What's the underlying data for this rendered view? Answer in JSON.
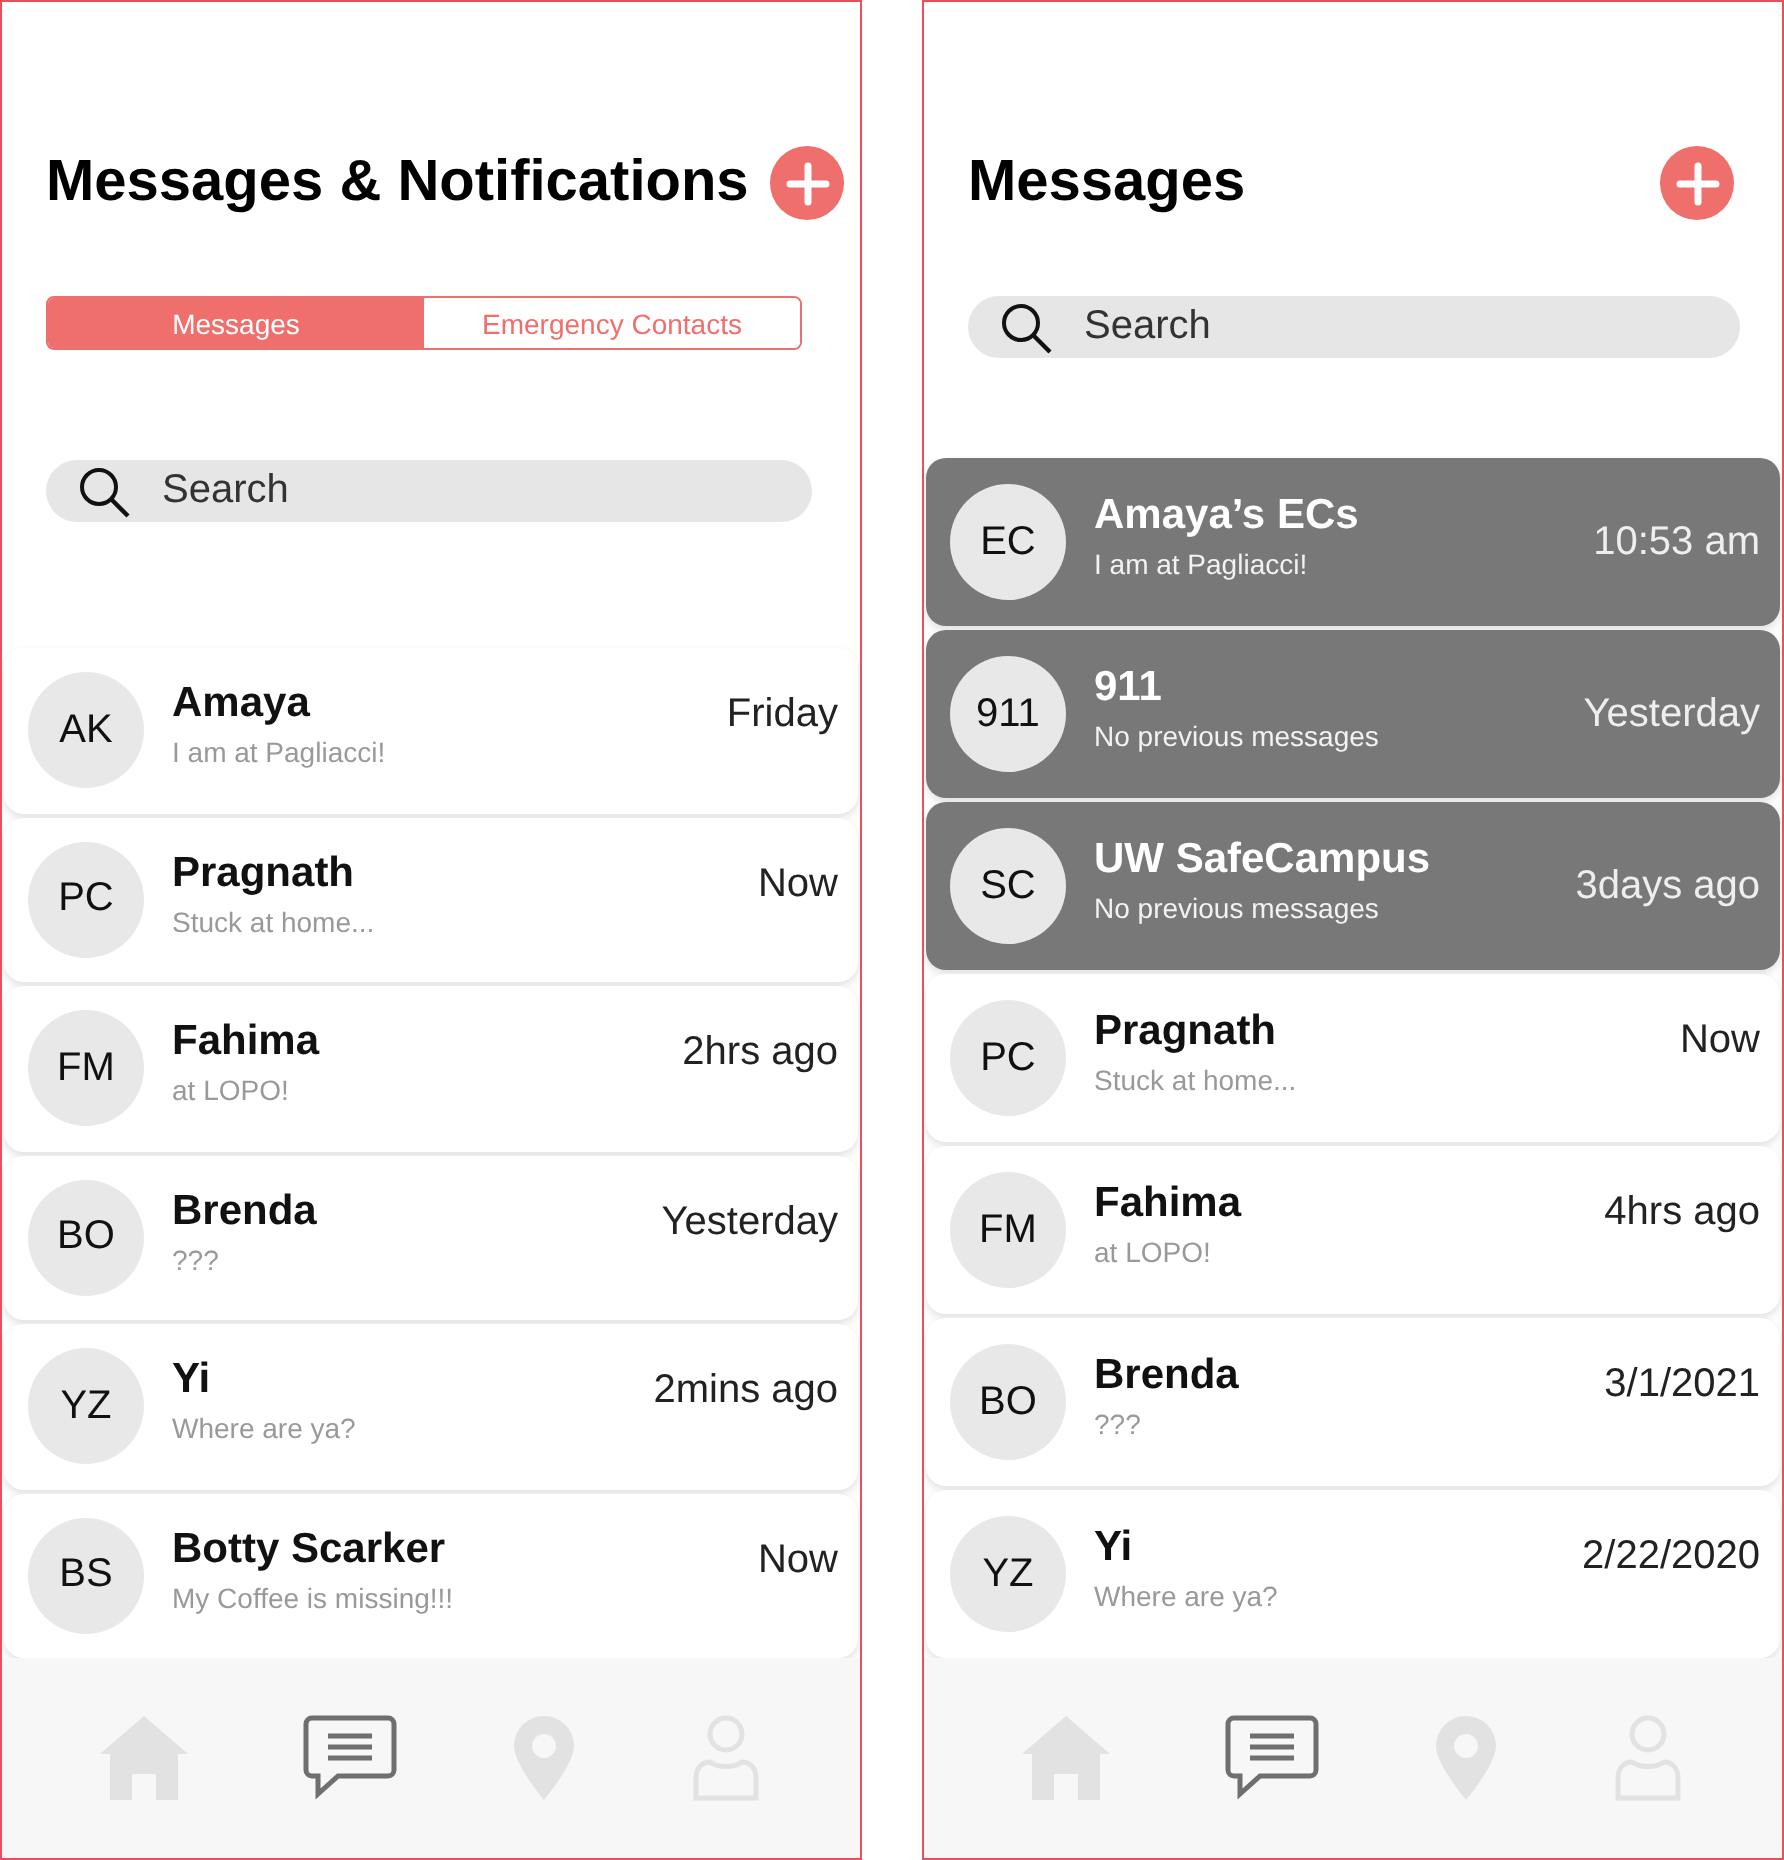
{
  "screens": [
    {
      "title": "Messages & Notifications",
      "tabs": [
        {
          "label": "Messages",
          "selected": true
        },
        {
          "label": "Emergency Contacts",
          "selected": false
        }
      ],
      "search": {
        "placeholder": "Search"
      },
      "conversations": [
        {
          "kind": "contact",
          "initials": "AK",
          "name": "Amaya",
          "preview": "I am at Pagliacci!",
          "time": "Friday"
        },
        {
          "kind": "contact",
          "initials": "PC",
          "name": "Pragnath",
          "preview": "Stuck at home...",
          "time": "Now"
        },
        {
          "kind": "contact",
          "initials": "FM",
          "name": "Fahima",
          "preview": "at LOPO!",
          "time": "2hrs ago"
        },
        {
          "kind": "contact",
          "initials": "BO",
          "name": "Brenda",
          "preview": "???",
          "time": "Yesterday"
        },
        {
          "kind": "contact",
          "initials": "YZ",
          "name": "Yi",
          "preview": "Where are ya?",
          "time": "2mins ago"
        },
        {
          "kind": "contact",
          "initials": "BS",
          "name": "Botty Scarker",
          "preview": "My Coffee is missing!!!",
          "time": "Now"
        }
      ],
      "nav": [
        {
          "kind": "home",
          "selected": false
        },
        {
          "kind": "messages",
          "selected": true
        },
        {
          "kind": "location",
          "selected": false
        },
        {
          "kind": "profile",
          "selected": false
        }
      ]
    },
    {
      "title": "Messages",
      "search": {
        "placeholder": "Search"
      },
      "conversations": [
        {
          "kind": "emergency",
          "initials": "EC",
          "name": "Amaya’s ECs",
          "preview": "I am at Pagliacci!",
          "time": "10:53 am"
        },
        {
          "kind": "emergency",
          "initials": "911",
          "name": "911",
          "preview": "No previous messages",
          "time": "Yesterday"
        },
        {
          "kind": "emergency",
          "initials": "SC",
          "name": "UW SafeCampus",
          "preview": "No previous messages",
          "time": "3days ago"
        },
        {
          "kind": "contact",
          "initials": "PC",
          "name": "Pragnath",
          "preview": "Stuck at home...",
          "time": "Now"
        },
        {
          "kind": "contact",
          "initials": "FM",
          "name": "Fahima",
          "preview": "at LOPO!",
          "time": "4hrs ago"
        },
        {
          "kind": "contact",
          "initials": "BO",
          "name": "Brenda",
          "preview": "???",
          "time": "3/1/2021"
        },
        {
          "kind": "contact",
          "initials": "YZ",
          "name": "Yi",
          "preview": "Where are ya?",
          "time": "2/22/2020"
        }
      ],
      "nav": [
        {
          "kind": "home",
          "selected": false
        },
        {
          "kind": "messages",
          "selected": true
        },
        {
          "kind": "location",
          "selected": false
        },
        {
          "kind": "profile",
          "selected": false
        }
      ]
    }
  ]
}
